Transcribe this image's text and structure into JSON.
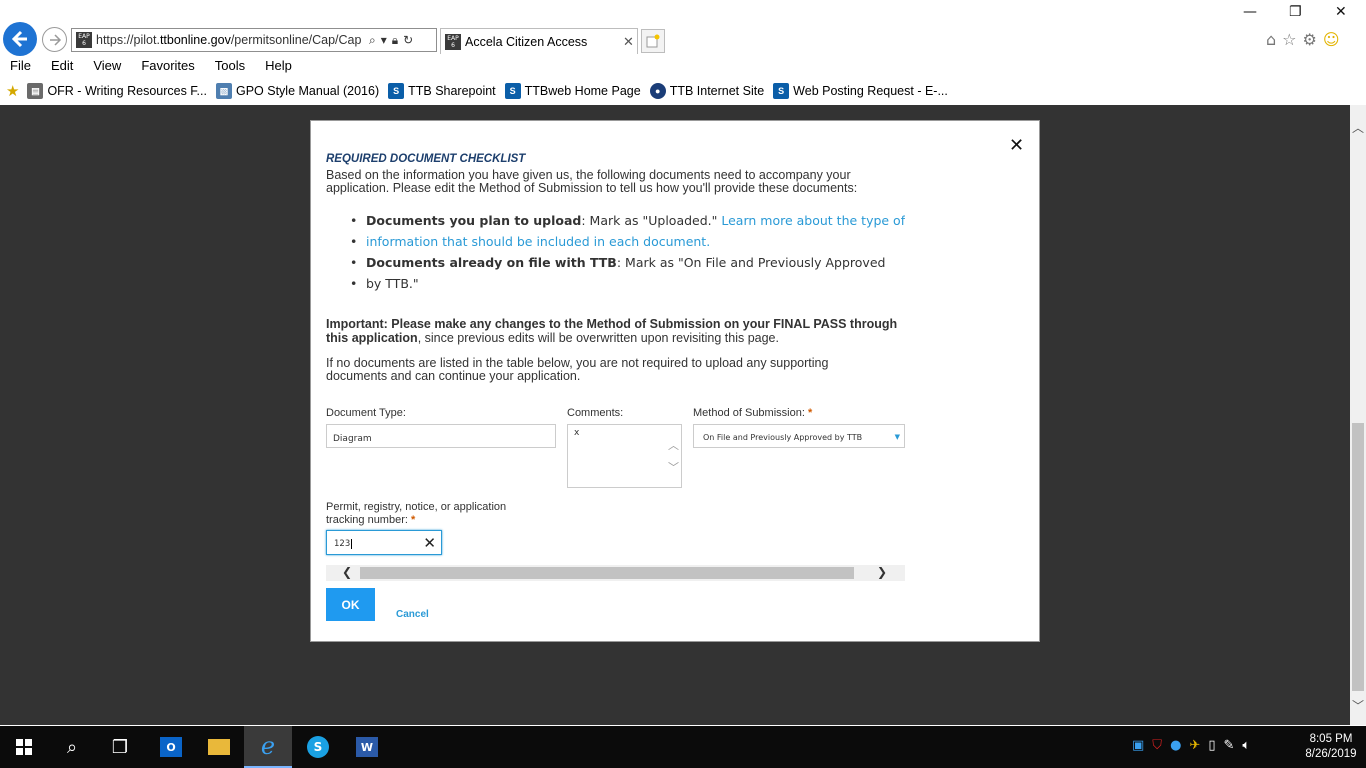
{
  "browser": {
    "url_prefix": "https://pilot.",
    "url_domain": "ttbonline.gov",
    "url_path": "/permitsonline/Cap/Cap",
    "eap_label": "EAP\n6",
    "tab_title": "Accela Citizen Access",
    "menu": [
      "File",
      "Edit",
      "View",
      "Favorites",
      "Tools",
      "Help"
    ],
    "favorites": [
      {
        "label": "OFR - Writing Resources F...",
        "color": "#6a6a6a",
        "glyph": "▤"
      },
      {
        "label": "GPO Style Manual (2016)",
        "color": "#4f7fb0",
        "glyph": "▧"
      },
      {
        "label": "TTB Sharepoint",
        "color": "#0b5ea8",
        "glyph": "S"
      },
      {
        "label": "TTBweb Home Page",
        "color": "#0b5ea8",
        "glyph": "S"
      },
      {
        "label": "TTB Internet Site",
        "color": "#1b3d78",
        "glyph": "●"
      },
      {
        "label": "Web Posting Request - E-...",
        "color": "#0b5ea8",
        "glyph": "S"
      }
    ]
  },
  "modal": {
    "title": "REQUIRED DOCUMENT CHECKLIST",
    "intro_line1": "Based on the information you have given us, the following documents need to accompany your",
    "intro_line2": "application. Please edit the Method of Submission to tell us how you'll provide these documents:",
    "bullet1_bold": "Documents you plan to upload",
    "bullet1_text": ": Mark as \"Uploaded.\" ",
    "bullet1_link_a": "Learn more about the type of",
    "bullet1_link_b": "information that should be included in each document.",
    "bullet2_bold": "Documents already on file with TTB",
    "bullet2_text": ": Mark as \"On File and Previously Approved",
    "bullet2_text_b": "by TTB.\"",
    "important_bold_a": "Important: Please make any changes to the Method of Submission on your FINAL PASS through",
    "important_bold_b": "this application",
    "important_rest": ", since previous edits will be overwritten upon revisiting this page.",
    "noreq_line1": "If no documents are listed in the table below, you are not required to upload any supporting",
    "noreq_line2": "documents and can continue your application.",
    "labels": {
      "doc_type": "Document Type:",
      "comments": "Comments:",
      "method": "Method of Submission:",
      "tracking_a": "Permit, registry, notice, or application",
      "tracking_b": "tracking number:",
      "required_mark": "*"
    },
    "values": {
      "doc_type": "Diagram",
      "comments": "x",
      "method": "On File and Previously Approved by TTB",
      "tracking": "123"
    },
    "ok_label": "OK",
    "cancel_label": "Cancel"
  },
  "taskbar": {
    "time": "8:05 PM",
    "date": "8/26/2019"
  }
}
